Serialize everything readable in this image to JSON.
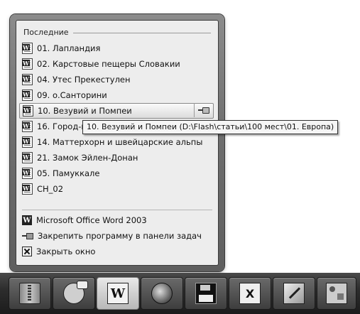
{
  "jump_list": {
    "recent_title": "Последние",
    "recent_items": [
      {
        "label": "01. Лапландия"
      },
      {
        "label": "02. Карстовые пещеры Словакии"
      },
      {
        "label": "04. Утес Прекестулен"
      },
      {
        "label": "09. о.Санторини"
      },
      {
        "label": "10. Везувий и Помпеи",
        "hovered": true
      },
      {
        "label": "16. Город-к"
      },
      {
        "label": "14. Маттерхорн и швейцарские альпы"
      },
      {
        "label": "21. Замок Эйлен-Донан"
      },
      {
        "label": "05. Памуккале"
      },
      {
        "label": "CH_02"
      }
    ],
    "tooltip": "10. Везувий и Помпеи (D:\\Flash\\статьи\\100 мест\\01. Европа)",
    "tasks": [
      {
        "label": "Microsoft Office Word 2003",
        "icon": "word-app-icon"
      },
      {
        "label": "Закрепить программу в панели задач",
        "icon": "pin-icon"
      },
      {
        "label": "Закрыть окно",
        "icon": "close-icon"
      }
    ]
  },
  "taskbar": {
    "buttons": [
      {
        "icon": "archive-icon"
      },
      {
        "icon": "chat-icon"
      },
      {
        "icon": "word-icon",
        "glyph": "W",
        "active": true
      },
      {
        "icon": "firefox-icon"
      },
      {
        "icon": "floppy-icon"
      },
      {
        "icon": "excel-icon",
        "glyph": "X"
      },
      {
        "icon": "pen-icon"
      },
      {
        "icon": "control-panel-icon"
      }
    ]
  }
}
